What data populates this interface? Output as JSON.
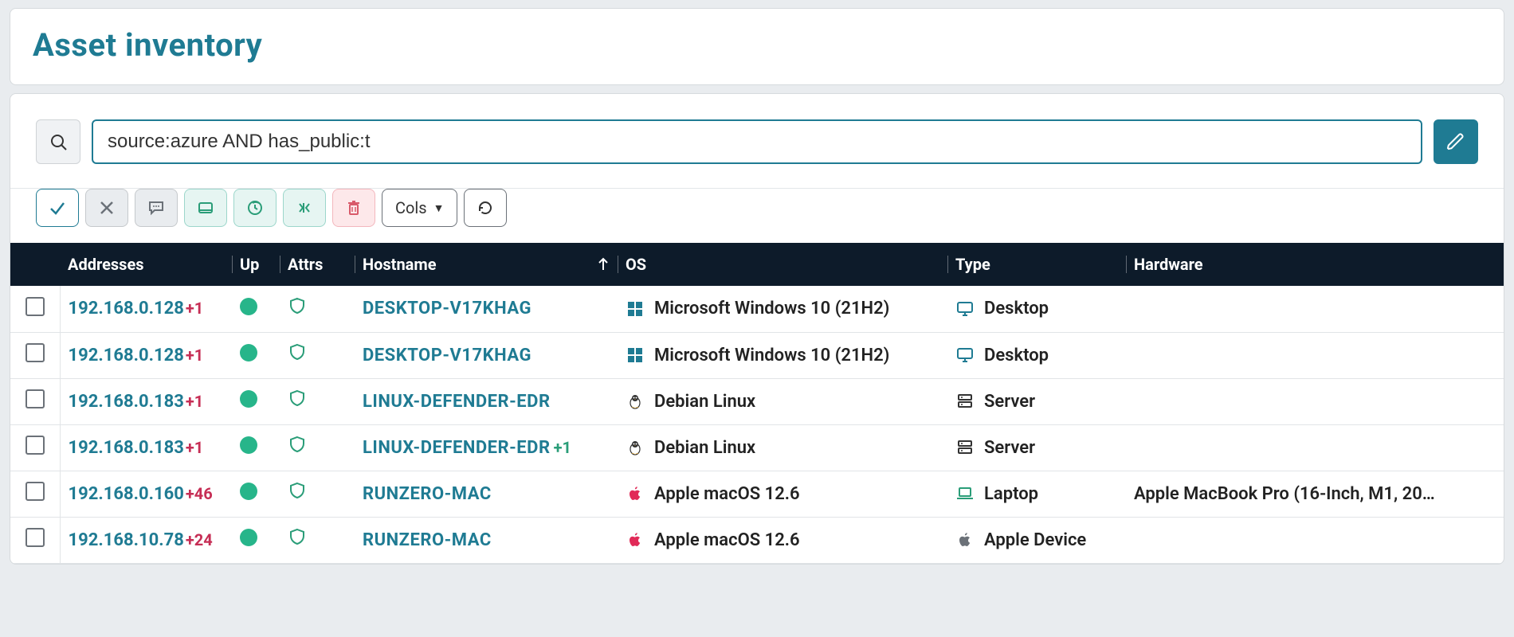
{
  "page": {
    "title": "Asset inventory"
  },
  "search": {
    "value": "source:azure AND has_public:t",
    "placeholder": ""
  },
  "toolbar": {
    "cols_label": "Cols"
  },
  "columns": {
    "addresses": "Addresses",
    "up": "Up",
    "attrs": "Attrs",
    "hostname": "Hostname",
    "os": "OS",
    "type": "Type",
    "hardware": "Hardware"
  },
  "rows": [
    {
      "addr": "192.168.0.128",
      "addr_extra": "+1",
      "host": "DESKTOP-V17KHAG",
      "host_extra": "",
      "os": "Microsoft Windows 10 (21H2)",
      "os_icon": "windows",
      "type": "Desktop",
      "type_icon": "desktop",
      "hw": ""
    },
    {
      "addr": "192.168.0.128",
      "addr_extra": "+1",
      "host": "DESKTOP-V17KHAG",
      "host_extra": "",
      "os": "Microsoft Windows 10 (21H2)",
      "os_icon": "windows",
      "type": "Desktop",
      "type_icon": "desktop",
      "hw": ""
    },
    {
      "addr": "192.168.0.183",
      "addr_extra": "+1",
      "host": "LINUX-DEFENDER-EDR",
      "host_extra": "",
      "os": "Debian Linux",
      "os_icon": "linux",
      "type": "Server",
      "type_icon": "server",
      "hw": ""
    },
    {
      "addr": "192.168.0.183",
      "addr_extra": "+1",
      "host": "LINUX-DEFENDER-EDR",
      "host_extra": "+1",
      "os": "Debian Linux",
      "os_icon": "linux",
      "type": "Server",
      "type_icon": "server",
      "hw": ""
    },
    {
      "addr": "192.168.0.160",
      "addr_extra": "+46",
      "host": "RUNZERO-MAC",
      "host_extra": "",
      "os": "Apple macOS 12.6",
      "os_icon": "apple-red",
      "type": "Laptop",
      "type_icon": "laptop",
      "hw": "Apple MacBook Pro (16-Inch, M1, 20…"
    },
    {
      "addr": "192.168.10.78",
      "addr_extra": "+24",
      "host": "RUNZERO-MAC",
      "host_extra": "",
      "os": "Apple macOS 12.6",
      "os_icon": "apple-red",
      "type": "Apple Device",
      "type_icon": "apple-gray",
      "hw": ""
    }
  ]
}
